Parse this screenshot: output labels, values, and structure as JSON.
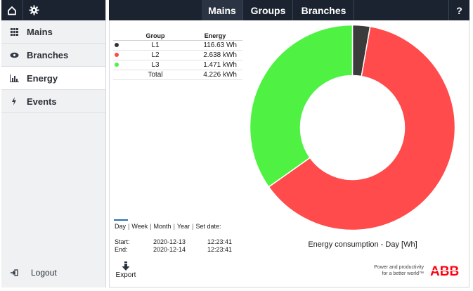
{
  "sidebar": {
    "items": [
      {
        "label": "Mains",
        "icon": "grid-icon"
      },
      {
        "label": "Branches",
        "icon": "eye-icon"
      },
      {
        "label": "Energy",
        "icon": "bar-chart-icon"
      },
      {
        "label": "Events",
        "icon": "lightning-icon"
      }
    ],
    "logout_label": "Logout"
  },
  "header": {
    "tabs": [
      {
        "label": "Mains",
        "active": true
      },
      {
        "label": "Groups",
        "active": false
      },
      {
        "label": "Branches",
        "active": false
      }
    ],
    "help_label": "?"
  },
  "table": {
    "headers": [
      "Group",
      "Energy"
    ],
    "rows": [
      {
        "group": "L1",
        "energy": "116.63 Wh",
        "color": "#333333"
      },
      {
        "group": "L2",
        "energy": "2.638 kWh",
        "color": "#fe4a4a"
      },
      {
        "group": "L3",
        "energy": "1.471 kWh",
        "color": "#4ef246"
      }
    ],
    "total_label": "Total",
    "total_value": "4.226 kWh"
  },
  "chart_data": {
    "type": "pie",
    "labels": [
      "L1",
      "L2",
      "L3"
    ],
    "values": [
      116.63,
      2638,
      1471
    ],
    "unit": "Wh",
    "colors": [
      "#3b3b3b",
      "#ff4b4b",
      "#4ff243"
    ],
    "title": "Energy consumption - Day [Wh]"
  },
  "range": {
    "options": [
      "Day",
      "Week",
      "Month",
      "Year",
      "Set date:"
    ],
    "selected": "Day"
  },
  "times": {
    "start_label": "Start:",
    "start_date": "2020-12-13",
    "start_time": "12:23:41",
    "end_label": "End:",
    "end_date": "2020-12-14",
    "end_time": "12:23:41"
  },
  "export_label": "Export",
  "brand": {
    "tagline_1": "Power and productivity",
    "tagline_2": "for a better world™"
  }
}
